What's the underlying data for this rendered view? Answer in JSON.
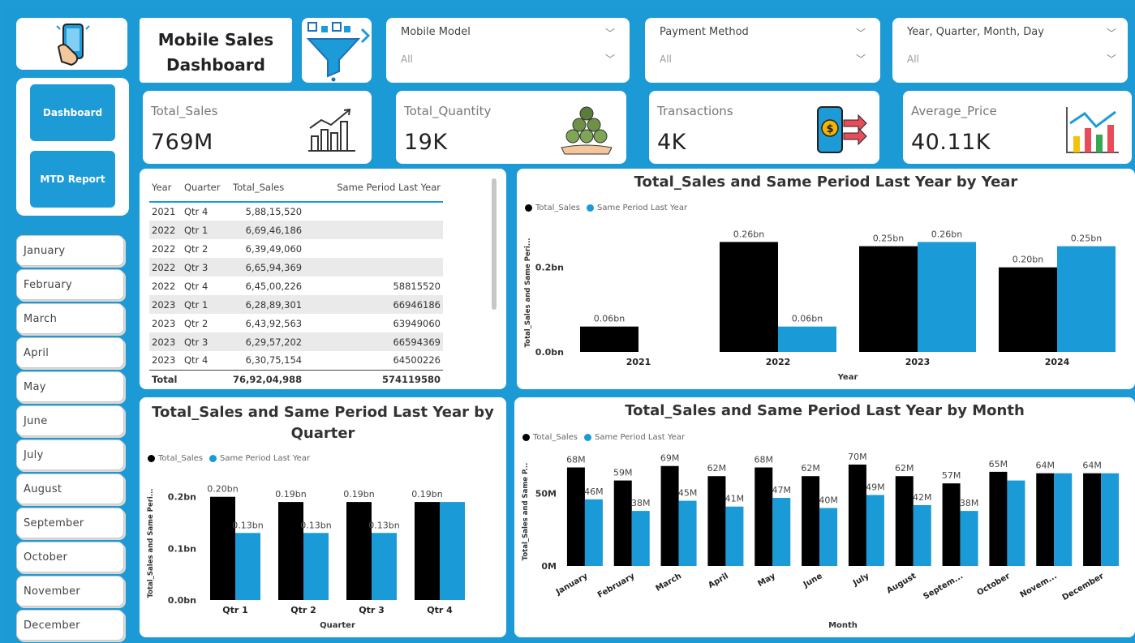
{
  "header": {
    "title_line1": "Mobile Sales",
    "title_line2": "Dashboard"
  },
  "nav": {
    "dashboard_label": "Dashboard",
    "mtd_label": "MTD Report"
  },
  "months": [
    "January",
    "February",
    "March",
    "April",
    "May",
    "June",
    "July",
    "August",
    "September",
    "October",
    "November",
    "December"
  ],
  "slicers": [
    {
      "title": "Mobile Model",
      "value": "All"
    },
    {
      "title": "Payment Method",
      "value": "All"
    },
    {
      "title": "Year, Quarter, Month, Day",
      "value": "All"
    }
  ],
  "kpis": [
    {
      "label": "Total_Sales",
      "value": "769M",
      "icon": "bar-growth-icon"
    },
    {
      "label": "Total_Quantity",
      "value": "19K",
      "icon": "coin-stack-icon"
    },
    {
      "label": "Transactions",
      "value": "4K",
      "icon": "mobile-payment-icon"
    },
    {
      "label": "Average_Price",
      "value": "40.11K",
      "icon": "trend-chart-icon"
    }
  ],
  "table": {
    "headers": [
      "Year",
      "Quarter",
      "Total_Sales",
      "Same Period Last Year"
    ],
    "rows": [
      [
        "2021",
        "Qtr 4",
        "5,88,15,520",
        ""
      ],
      [
        "2022",
        "Qtr 1",
        "6,69,46,186",
        ""
      ],
      [
        "2022",
        "Qtr 2",
        "6,39,49,060",
        ""
      ],
      [
        "2022",
        "Qtr 3",
        "6,65,94,369",
        ""
      ],
      [
        "2022",
        "Qtr 4",
        "6,45,00,226",
        "58815520"
      ],
      [
        "2023",
        "Qtr 1",
        "6,28,89,301",
        "66946186"
      ],
      [
        "2023",
        "Qtr 2",
        "6,43,92,563",
        "63949060"
      ],
      [
        "2023",
        "Qtr 3",
        "6,29,57,202",
        "66594369"
      ],
      [
        "2023",
        "Qtr 4",
        "6,30,75,154",
        "64500226"
      ]
    ],
    "total": [
      "Total",
      "",
      "76,92,04,988",
      "574119580"
    ]
  },
  "colors": {
    "series1": "#000000",
    "series2": "#1a9ad6",
    "accent": "#1d9bd6"
  },
  "legend": {
    "s1": "Total_Sales",
    "s2": "Same Period Last Year"
  },
  "chart_data": [
    {
      "type": "bar",
      "title": "Total_Sales and Same Period Last Year by Year",
      "xlabel": "Year",
      "ylabel": "Total_Sales and Same Peri...",
      "categories": [
        "2021",
        "2022",
        "2023",
        "2024"
      ],
      "series": [
        {
          "name": "Total_Sales",
          "values": [
            0.06,
            0.26,
            0.25,
            0.2
          ],
          "labels": [
            "0.06bn",
            "0.26bn",
            "0.25bn",
            "0.20bn"
          ]
        },
        {
          "name": "Same Period Last Year",
          "values": [
            0,
            0.06,
            0.26,
            0.25
          ],
          "labels": [
            "",
            "0.06bn",
            "0.26bn",
            "0.25bn"
          ]
        }
      ],
      "yticks": [
        "0.0bn",
        "0.2bn"
      ],
      "ytick_values": [
        0,
        0.2
      ],
      "ylim": [
        0,
        0.28
      ],
      "legend_position": "top-left"
    },
    {
      "type": "bar",
      "title": "Total_Sales and Same Period Last Year by Quarter",
      "xlabel": "Quarter",
      "ylabel": "Total_Sales and Same Peri...",
      "categories": [
        "Qtr 1",
        "Qtr 2",
        "Qtr 3",
        "Qtr 4"
      ],
      "series": [
        {
          "name": "Total_Sales",
          "values": [
            0.2,
            0.19,
            0.19,
            0.19
          ],
          "labels": [
            "0.20bn",
            "0.19bn",
            "0.19bn",
            "0.19bn"
          ]
        },
        {
          "name": "Same Period Last Year",
          "values": [
            0.13,
            0.13,
            0.13,
            0.19
          ],
          "labels": [
            "0.13bn",
            "0.13bn",
            "0.13bn",
            ""
          ]
        }
      ],
      "yticks": [
        "0.0bn",
        "0.1bn",
        "0.2bn"
      ],
      "ytick_values": [
        0,
        0.1,
        0.2
      ],
      "ylim": [
        0,
        0.22
      ],
      "legend_position": "top-left"
    },
    {
      "type": "bar",
      "title": "Total_Sales and Same Period Last Year by Month",
      "xlabel": "Month",
      "ylabel": "Total_Sales and Same P...",
      "categories": [
        "January",
        "February",
        "March",
        "April",
        "May",
        "June",
        "July",
        "August",
        "Septem...",
        "October",
        "Novem...",
        "December"
      ],
      "series": [
        {
          "name": "Total_Sales",
          "values": [
            68,
            59,
            69,
            62,
            68,
            62,
            70,
            62,
            57,
            65,
            64,
            64
          ],
          "labels": [
            "68M",
            "59M",
            "69M",
            "62M",
            "68M",
            "62M",
            "70M",
            "62M",
            "57M",
            "65M",
            "64M",
            "64M"
          ]
        },
        {
          "name": "Same Period Last Year",
          "values": [
            46,
            38,
            45,
            41,
            47,
            40,
            49,
            42,
            38,
            59,
            64,
            64
          ],
          "labels": [
            "46M",
            "38M",
            "45M",
            "41M",
            "47M",
            "40M",
            "49M",
            "42M",
            "38M",
            "",
            "",
            ""
          ]
        }
      ],
      "yticks": [
        "0M",
        "50M"
      ],
      "ytick_values": [
        0,
        50
      ],
      "ylim": [
        0,
        75
      ],
      "legend_position": "top-left"
    }
  ]
}
